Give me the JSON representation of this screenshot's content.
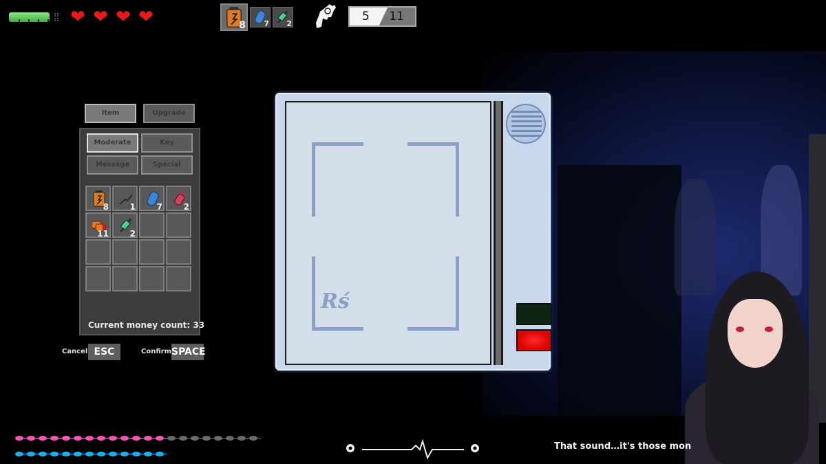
{
  "hud": {
    "stamina": {
      "fraction": 0.9,
      "color": "#5fcf5a"
    },
    "hearts": {
      "count": 4,
      "glyph": "❤",
      "color": "#f01818"
    },
    "quickbar": [
      {
        "icon": "battery-icon",
        "count": "8",
        "selected": true
      },
      {
        "icon": "capsule-icon",
        "count": "7",
        "selected": false
      },
      {
        "icon": "syringe-icon",
        "count": "2",
        "selected": false
      }
    ],
    "weapon_icon": "revolver-icon",
    "ammo": {
      "loaded": "5",
      "reserve": "11"
    }
  },
  "inventory": {
    "main_tabs": [
      {
        "label": "Item",
        "active": true
      },
      {
        "label": "Upgrade",
        "active": false
      }
    ],
    "sub_tabs": [
      {
        "label": "Moderate",
        "active": true
      },
      {
        "label": "Key",
        "active": false
      },
      {
        "label": "Message",
        "active": false
      },
      {
        "label": "Special",
        "active": false
      }
    ],
    "slots": [
      {
        "icon": "battery-icon",
        "count": "8"
      },
      {
        "icon": "wire-icon",
        "count": "1"
      },
      {
        "icon": "capsule-icon",
        "count": "7"
      },
      {
        "icon": "bottle-icon",
        "count": "2"
      },
      {
        "icon": "shells-icon",
        "count": "11"
      },
      {
        "icon": "syringe-icon",
        "count": "2"
      },
      {
        "icon": "",
        "count": ""
      },
      {
        "icon": "",
        "count": ""
      },
      {
        "icon": "",
        "count": ""
      },
      {
        "icon": "",
        "count": ""
      },
      {
        "icon": "",
        "count": ""
      },
      {
        "icon": "",
        "count": ""
      },
      {
        "icon": "",
        "count": ""
      },
      {
        "icon": "",
        "count": ""
      },
      {
        "icon": "",
        "count": ""
      },
      {
        "icon": "",
        "count": ""
      }
    ],
    "money_text": "Current money count: 33",
    "cancel": {
      "label": "Cancel",
      "key": "ESC"
    },
    "confirm": {
      "label": "Confirm",
      "key": "SPACE"
    }
  },
  "device": {
    "logo": "Rś",
    "indicators": {
      "green": "off",
      "red": "on"
    }
  },
  "bottom": {
    "pink_bar": {
      "filled": 13,
      "total": 21,
      "color": "#ff4fbf",
      "empty_color": "#6a6a6a"
    },
    "blue_bar": {
      "filled": 13,
      "total": 13,
      "color": "#1ab0f0"
    },
    "subtitle": "That sound…it's those mon"
  }
}
